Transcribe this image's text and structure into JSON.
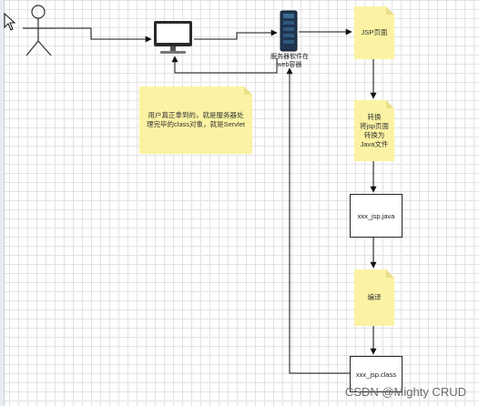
{
  "nodes": {
    "server_label": "服务器软件在\nweb容器",
    "jsp_page": "JSP页面",
    "convert_note": "转换\n将jsp页面\n转换为\nJava文件",
    "java_file": "xxx_jsp.java",
    "compile_note": "编译",
    "class_file": "xxx_jsp.class",
    "servlet_note": "用户真正拿到的，就是服务器处\n理完毕的class对象，就是Servlet"
  },
  "watermark": "CSDN @Mighty CRUD"
}
